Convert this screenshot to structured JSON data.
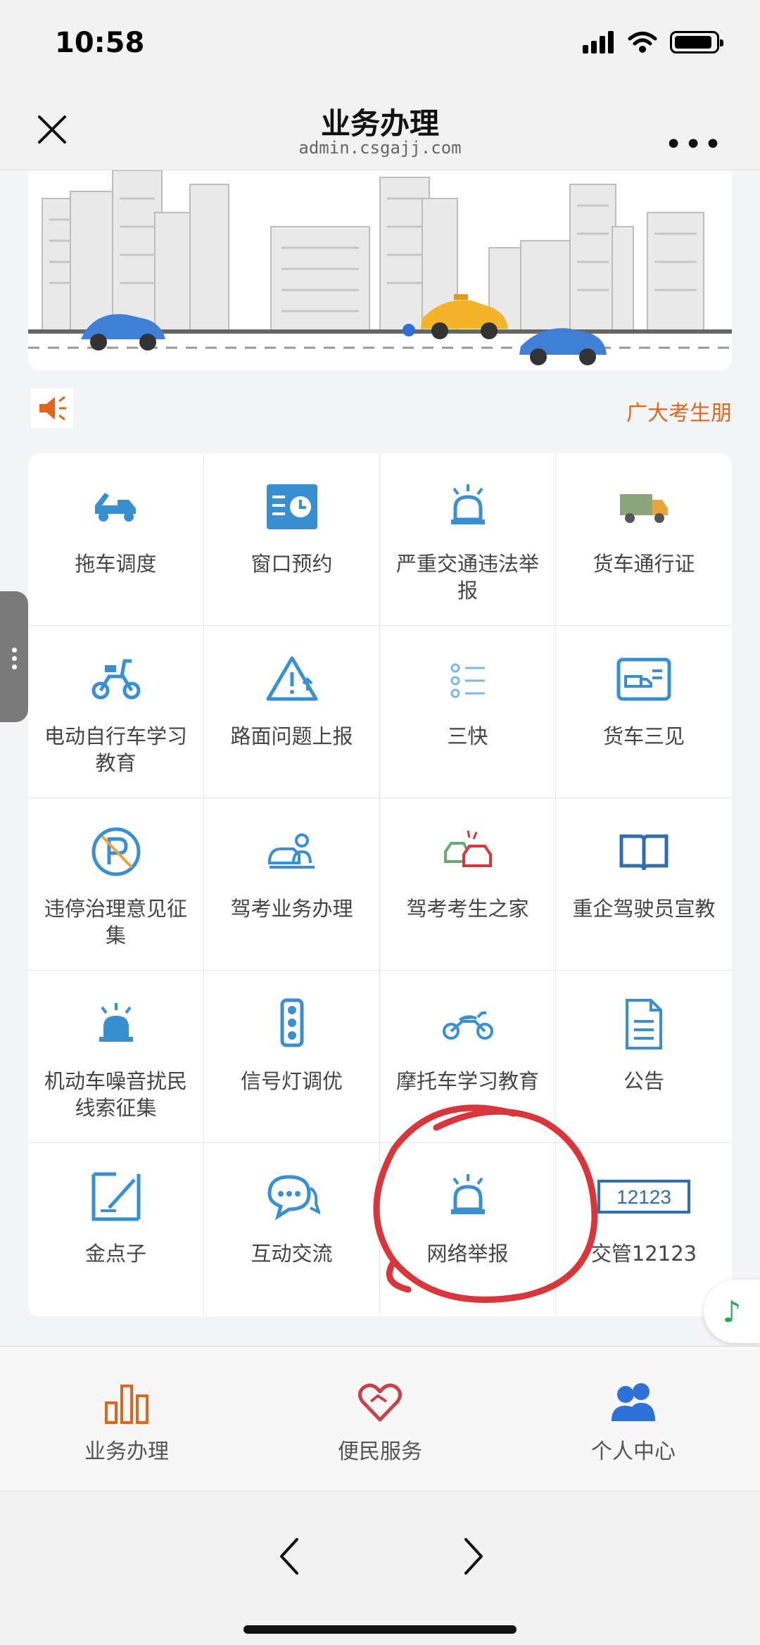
{
  "status": {
    "time": "10:58"
  },
  "nav": {
    "title": "业务办理",
    "subtitle": "admin.csgajj.com"
  },
  "notice": {
    "text": "广大考生朋"
  },
  "grid": {
    "items": [
      {
        "label": "拖车调度",
        "icon": "tow-truck-icon"
      },
      {
        "label": "窗口预约",
        "icon": "clock-card-icon"
      },
      {
        "label": "严重交通违法举报",
        "icon": "alarm-light-icon"
      },
      {
        "label": "货车通行证",
        "icon": "truck-icon"
      },
      {
        "label": "电动自行车学习教育",
        "icon": "e-bike-icon"
      },
      {
        "label": "路面问题上报",
        "icon": "warning-icon"
      },
      {
        "label": "三快",
        "icon": "list-icon"
      },
      {
        "label": "货车三见",
        "icon": "truck-card-icon"
      },
      {
        "label": "违停治理意见征集",
        "icon": "no-parking-icon"
      },
      {
        "label": "驾考业务办理",
        "icon": "driver-exam-icon"
      },
      {
        "label": "驾考考生之家",
        "icon": "car-crash-icon"
      },
      {
        "label": "重企驾驶员宣教",
        "icon": "book-icon"
      },
      {
        "label": "机动车噪音扰民线索征集",
        "icon": "siren-icon"
      },
      {
        "label": "信号灯调优",
        "icon": "traffic-light-icon"
      },
      {
        "label": "摩托车学习教育",
        "icon": "motorcycle-icon"
      },
      {
        "label": "公告",
        "icon": "document-icon"
      },
      {
        "label": "金点子",
        "icon": "edit-icon"
      },
      {
        "label": "互动交流",
        "icon": "chat-icon"
      },
      {
        "label": "网络举报",
        "icon": "alarm-light-icon"
      },
      {
        "label": "交管12123",
        "icon": "badge-12123-icon"
      }
    ]
  },
  "badge_12123": "12123",
  "tabs": [
    {
      "label": "业务办理",
      "icon": "bar-chart-icon"
    },
    {
      "label": "便民服务",
      "icon": "heart-icon"
    },
    {
      "label": "个人中心",
      "icon": "users-icon"
    }
  ],
  "colors": {
    "accent_blue": "#3a8fd0",
    "orange": "#e0661e",
    "red_annotation": "#d8363a"
  }
}
